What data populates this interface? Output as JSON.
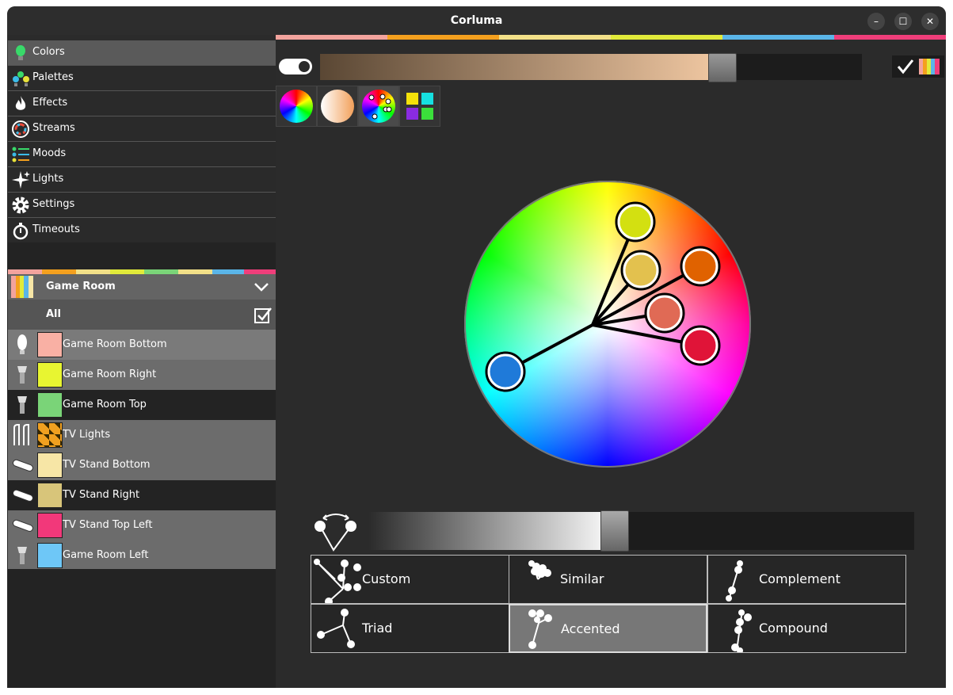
{
  "window": {
    "title": "Corluma",
    "controls": [
      "–",
      "☐",
      "✕"
    ]
  },
  "colors": {
    "accent_stripe": [
      "#f2a39d",
      "#f4a01e",
      "#f2e088",
      "#e1ea3a",
      "#5ab5e8",
      "#ef3e7a"
    ]
  },
  "nav": [
    {
      "label": "Colors",
      "icon": "bulb-icon",
      "active": true
    },
    {
      "label": "Palettes",
      "icon": "palette-bulbs-icon"
    },
    {
      "label": "Effects",
      "icon": "flame-icon"
    },
    {
      "label": "Streams",
      "icon": "stream-ring-icon"
    },
    {
      "label": "Moods",
      "icon": "moods-list-icon"
    },
    {
      "label": "Lights",
      "icon": "sparkle-icon"
    },
    {
      "label": "Settings",
      "icon": "gear-icon"
    },
    {
      "label": "Timeouts",
      "icon": "stopwatch-icon"
    }
  ],
  "group": {
    "name": "Game Room",
    "all_label": "All",
    "lights": [
      {
        "name": "Game Room Bottom",
        "color": "#f9b0a4",
        "type": "bulb",
        "row": "#7a7a7a"
      },
      {
        "name": "Game Room Right",
        "color": "#e8f531",
        "type": "lamp",
        "row": "#6c6c6c"
      },
      {
        "name": "Game Room Top",
        "color": "#7ad478",
        "type": "lamp",
        "row": "#232323"
      },
      {
        "name": "TV Lights",
        "color": "#f0a020",
        "type": "strip",
        "row": "#6c6c6c"
      },
      {
        "name": "TV Stand Bottom",
        "color": "#f7e6a6",
        "type": "bar",
        "row": "#6c6c6c"
      },
      {
        "name": "TV Stand Right",
        "color": "#d8c57a",
        "type": "bar",
        "row": "#232323"
      },
      {
        "name": "TV Stand Top Left",
        "color": "#f2387a",
        "type": "bar",
        "row": "#6c6c6c"
      },
      {
        "name": "Game Room Left",
        "color": "#6ec7f7",
        "type": "lamp",
        "row": "#6c6c6c"
      }
    ]
  },
  "controls": {
    "power_on": true,
    "brightness_percent": 80,
    "spread_percent": 46
  },
  "tabs": [
    "rgb-wheel-icon",
    "temperature-icon",
    "multi-color-wheel-icon",
    "color-grid-icon"
  ],
  "wheel_points": [
    {
      "color": "#d3e011"
    },
    {
      "color": "#e3c14e"
    },
    {
      "color": "#e06200"
    },
    {
      "color": "#e06a55"
    },
    {
      "color": "#e01438"
    },
    {
      "color": "#1f7ad9"
    }
  ],
  "harmony_modes": [
    {
      "label": "Custom",
      "active": false
    },
    {
      "label": "Similar",
      "active": false
    },
    {
      "label": "Complement",
      "active": false
    },
    {
      "label": "Triad",
      "active": false
    },
    {
      "label": "Accented",
      "active": true
    },
    {
      "label": "Compound",
      "active": false
    }
  ]
}
